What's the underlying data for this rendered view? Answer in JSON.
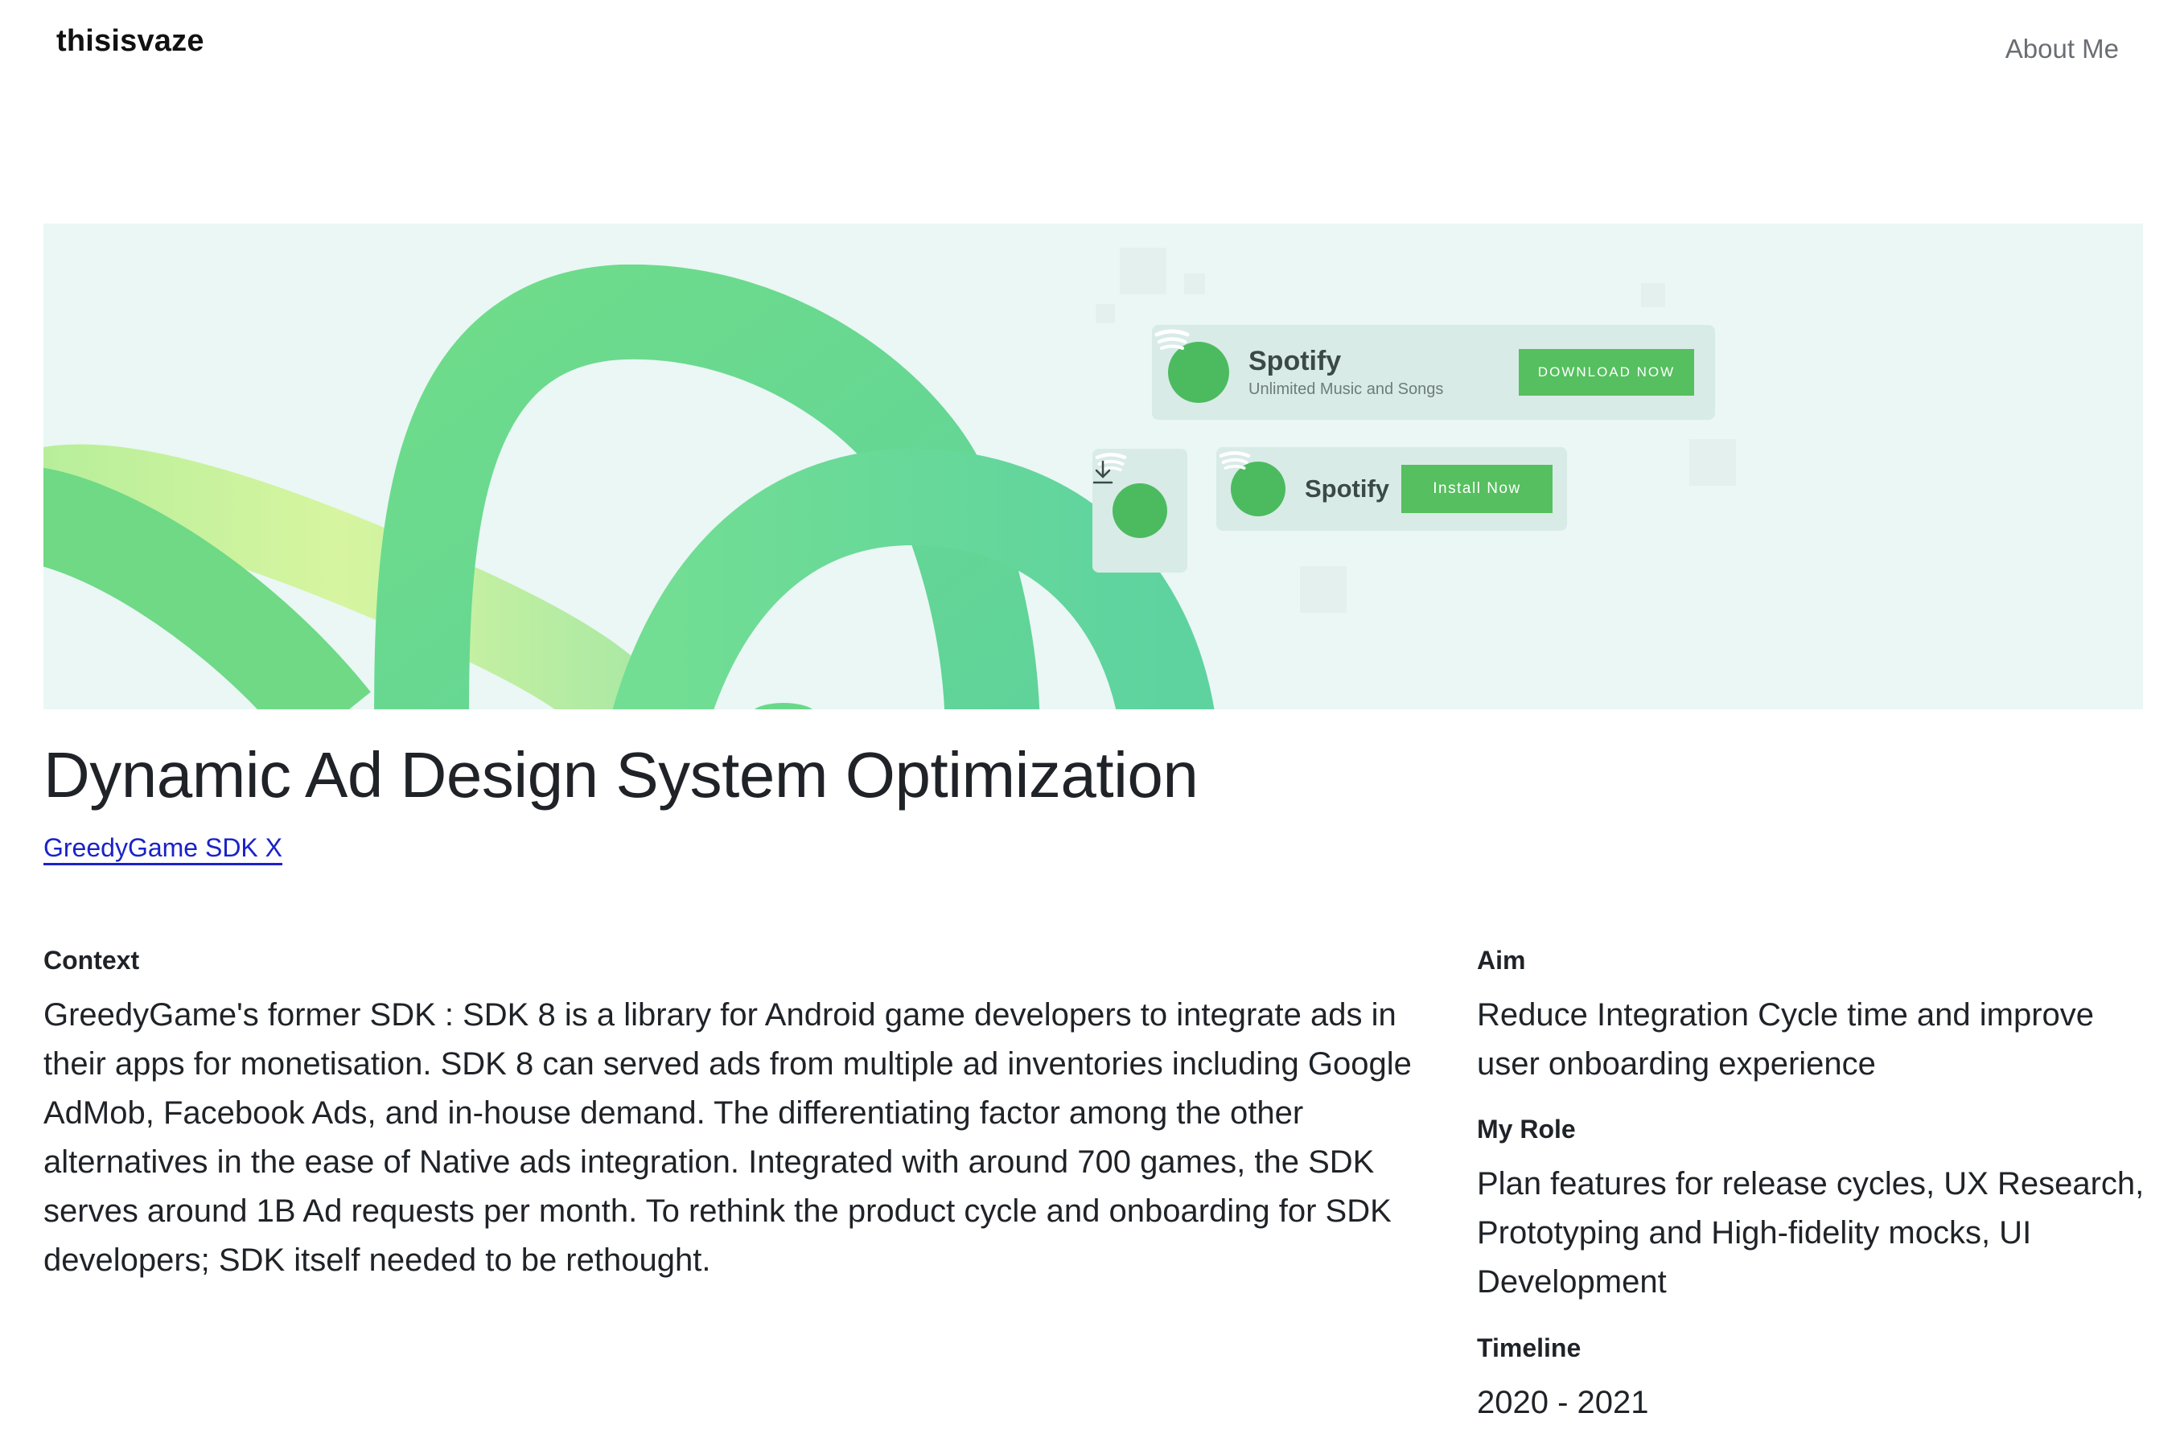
{
  "header": {
    "brand": "thisisvaze",
    "nav_about": "About Me"
  },
  "hero": {
    "ad_card_1": {
      "title": "Spotify",
      "subtitle": "Unlimited Music and Songs",
      "button": "DOWNLOAD NOW"
    },
    "ad_card_2": {
      "title": "Spotify",
      "button": "Install Now"
    },
    "colors": {
      "background": "#eaf7f5",
      "accent_green": "#56bf5f"
    },
    "icons": [
      "spotify-icon",
      "download-icon"
    ]
  },
  "project": {
    "title": "Dynamic Ad Design System Optimization",
    "subtitle_link": "GreedyGame SDK X"
  },
  "context": {
    "label": "Context",
    "text": "GreedyGame's former SDK : SDK 8 is a library for Android game developers to integrate ads in their apps for monetisation. SDK 8 can served ads from multiple ad inventories including Google AdMob, Facebook Ads, and in-house demand. The differentiating factor among the other alternatives in the ease of Native ads integration. Integrated with around 700 games, the SDK serves around 1B Ad requests per month. To rethink the product cycle and onboarding for SDK developers; SDK itself needed to be rethought."
  },
  "aim": {
    "label": "Aim",
    "text": "Reduce Integration Cycle time and improve user onboarding experience"
  },
  "role": {
    "label": "My Role",
    "text": "Plan features for release cycles, UX Research, Prototyping and High-fidelity mocks, UI Development"
  },
  "timeline": {
    "label": "Timeline",
    "text": "2020 - 2021"
  }
}
